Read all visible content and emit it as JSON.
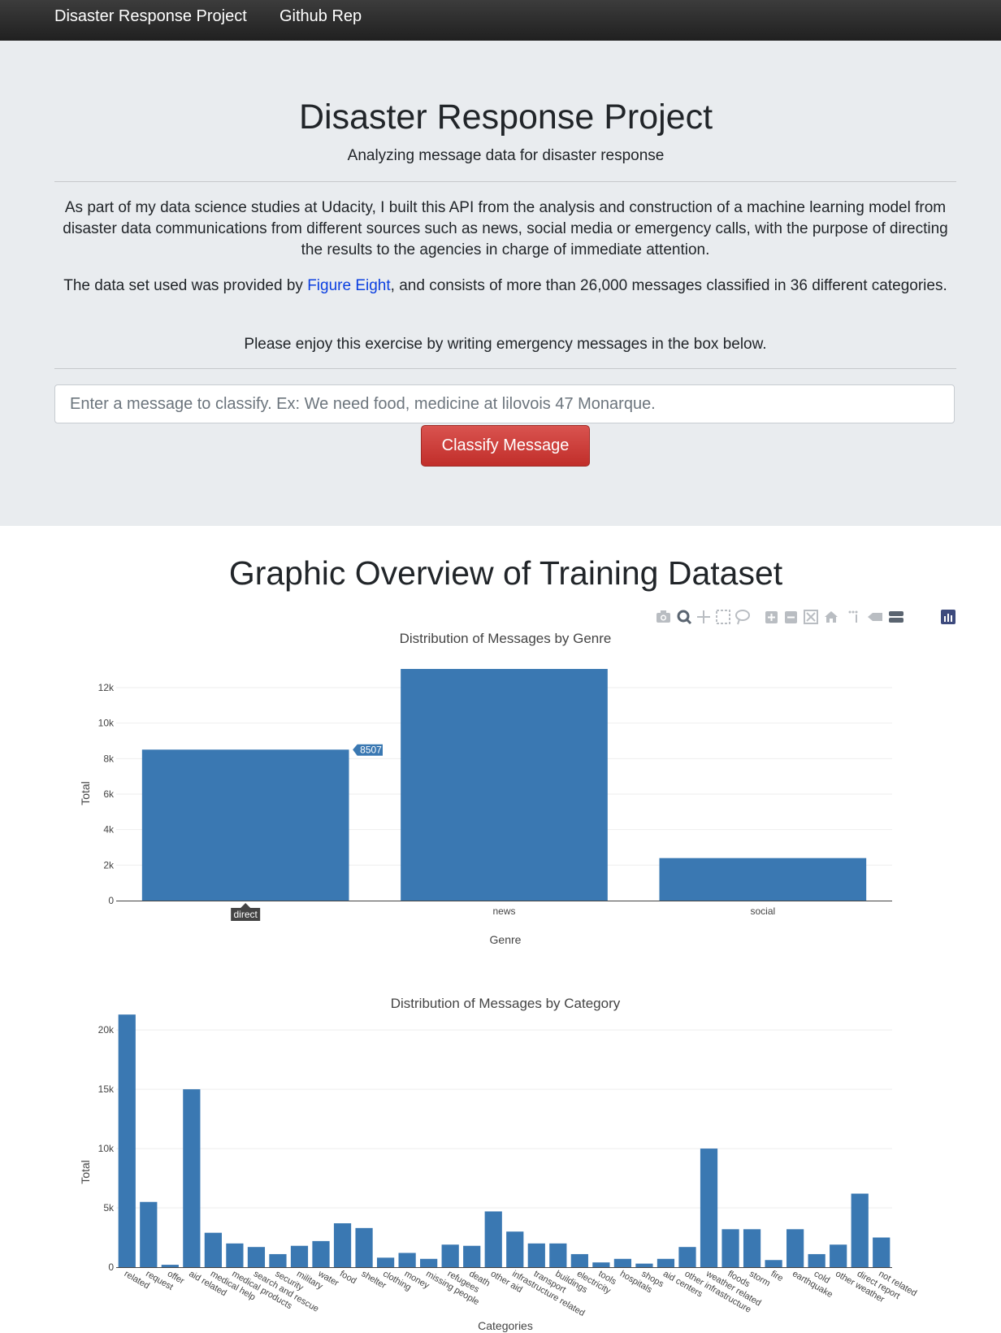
{
  "navbar": {
    "brand": "Disaster Response Project",
    "github_link": "Github Rep"
  },
  "header": {
    "title": "Disaster Response Project",
    "subtitle": "Analyzing message data for disaster response"
  },
  "intro": {
    "paragraph1": "As part of my data science studies at Udacity, I built this API from the analysis and construction of a machine learning model from disaster data communications from different sources such as news, social media or emergency calls, with the purpose of directing the results to the agencies in charge of immediate attention.",
    "paragraph2_before": "The data set used was provided by ",
    "paragraph2_link": "Figure Eight",
    "paragraph2_after": ", and consists of more than 26,000 messages classified in 36 different categories.",
    "paragraph3": "Please enjoy this exercise by writing emergency messages in the box below."
  },
  "form": {
    "input_value": "",
    "input_placeholder": "Enter a message to classify. Ex: We need food, medicine at lilovois 47 Monarque.",
    "button_label": "Classify Message"
  },
  "overview": {
    "title": "Graphic Overview of Training Dataset"
  },
  "modebar": {
    "icons": [
      "camera-icon",
      "zoom-icon",
      "pan-icon",
      "box-select-icon",
      "lasso-select-icon",
      "zoom-in-icon",
      "zoom-out-icon",
      "autoscale-icon",
      "reset-axes-icon",
      "spike-lines-icon",
      "hover-closest-icon",
      "hover-compare-icon",
      "plotly-logo-icon"
    ]
  },
  "colors": {
    "bar": "#3a78b2",
    "danger": "#d9534f",
    "jumbotron": "#e9ecef",
    "link": "#0b3fe0"
  },
  "chart_data": [
    {
      "type": "bar",
      "title": "Distribution of Messages by Genre",
      "xlabel": "Genre",
      "ylabel": "Total",
      "categories": [
        "direct",
        "news",
        "social"
      ],
      "values": [
        8507,
        13054,
        2396
      ],
      "ylim": [
        0,
        13741
      ],
      "yticks": [
        0,
        2000,
        4000,
        6000,
        8000,
        10000,
        12000
      ],
      "ytick_labels": [
        "0",
        "2k",
        "4k",
        "6k",
        "8k",
        "10k",
        "12k"
      ],
      "grid": true,
      "hover": {
        "category": "direct",
        "value_label": "8507",
        "axis_label": "direct"
      }
    },
    {
      "type": "bar",
      "title": "Distribution of Messages by Category",
      "xlabel": "Categories",
      "ylabel": "Total",
      "categories": [
        "related",
        "request",
        "offer",
        "aid related",
        "medical help",
        "medical products",
        "search and rescue",
        "security",
        "military",
        "water",
        "food",
        "shelter",
        "clothing",
        "money",
        "missing people",
        "refugees",
        "death",
        "other aid",
        "infrastructure related",
        "transport",
        "buildings",
        "electricity",
        "tools",
        "hospitals",
        "shops",
        "aid centers",
        "other infrastructure",
        "weather related",
        "floods",
        "storm",
        "fire",
        "earthquake",
        "cold",
        "other weather",
        "direct report",
        "not related"
      ],
      "values": [
        21300,
        5500,
        200,
        15000,
        2900,
        2000,
        1700,
        1100,
        1800,
        2200,
        3700,
        3300,
        800,
        1200,
        700,
        1900,
        1800,
        4700,
        3000,
        2000,
        2000,
        1100,
        400,
        700,
        300,
        700,
        1700,
        10000,
        3200,
        3200,
        600,
        3200,
        1100,
        1900,
        6200,
        2500
      ],
      "ylim": [
        0,
        22000
      ],
      "yticks": [
        0,
        5000,
        10000,
        15000,
        20000
      ],
      "ytick_labels": [
        "0",
        "5k",
        "10k",
        "15k",
        "20k"
      ],
      "grid": true
    }
  ]
}
